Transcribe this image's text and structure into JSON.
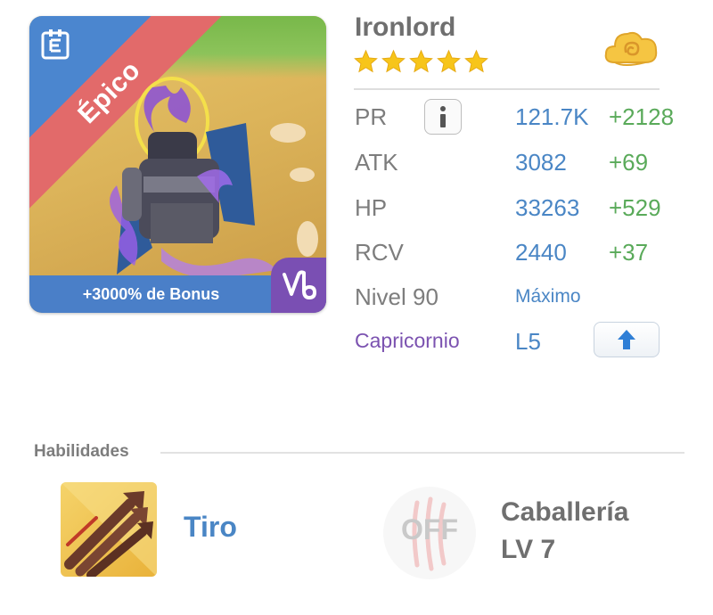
{
  "hero": {
    "rarity": "Épico",
    "bonus": "+3000% de Bonus",
    "name": "Ironlord",
    "stars": 5,
    "element_icon": "element-e-icon",
    "zodiac_icon": "capricorn-icon"
  },
  "stats": {
    "pr": {
      "label": "PR",
      "value": "121.7K",
      "bonus": "+2128"
    },
    "atk": {
      "label": "ATK",
      "value": "3082",
      "bonus": "+69"
    },
    "hp": {
      "label": "HP",
      "value": "33263",
      "bonus": "+529"
    },
    "rcv": {
      "label": "RCV",
      "value": "2440",
      "bonus": "+37"
    },
    "level": {
      "label": "Nivel 90",
      "value": "Máximo"
    },
    "zodiac": {
      "label": "Capricornio",
      "value": "L5"
    }
  },
  "skills": {
    "title": "Habilidades",
    "active": {
      "name": "Tiro",
      "icon": "arrows-icon"
    },
    "passive": {
      "state": "OFF",
      "name": "Caballería",
      "level": "LV 7",
      "icon": "claw-icon"
    }
  },
  "colors": {
    "accent_blue": "#4a86c5",
    "bonus_green": "#5aaa5a",
    "zodiac_purple": "#7b52b0",
    "rarity_red": "#e26a6a"
  }
}
